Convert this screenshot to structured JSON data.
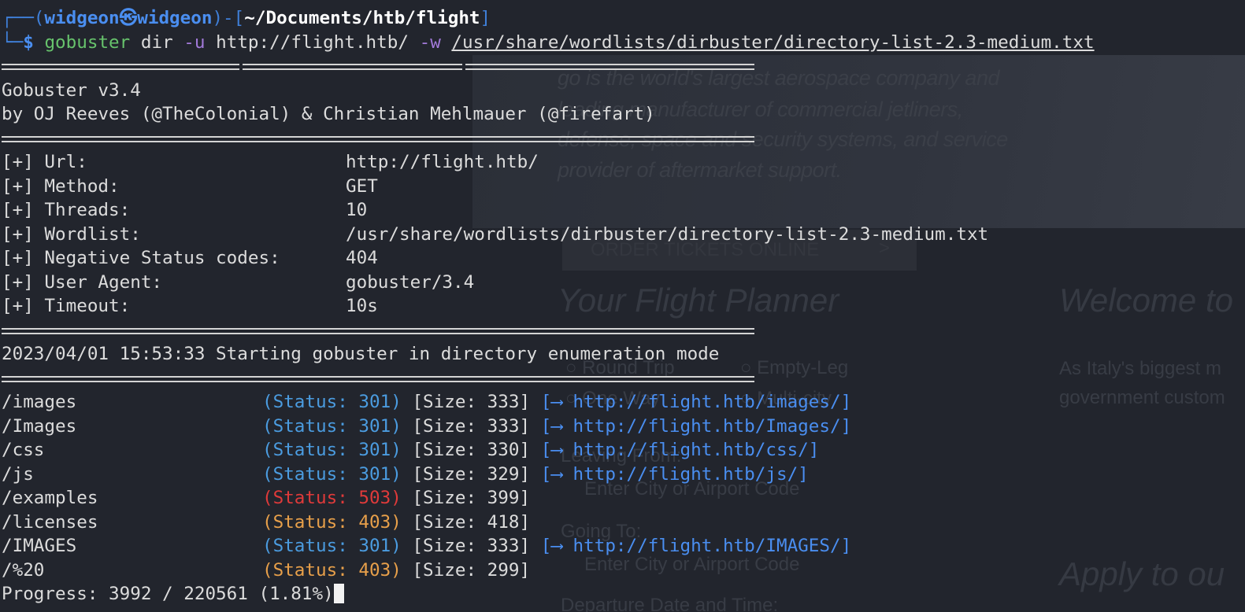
{
  "background_page": {
    "hero_lines": [
      "go is the world's largest aerospace company and",
      "leading manufacturer of commercial jetliners,",
      "defense, space and security systems, and service",
      "provider of aftermarket support."
    ],
    "order_button": "ORDER TICKETS ONLINE",
    "order_arrow": ">",
    "planner_heading": "Your Flight Planner",
    "welcome_heading": "Welcome to",
    "trip_options": [
      "Round Trip",
      "Empty-Leg",
      "One Way",
      "Multi-city"
    ],
    "intro_lines": [
      "As Italy's biggest m",
      "government custom"
    ],
    "leaving_label": "Leaving From:",
    "leaving_placeholder": "Enter City or Airport Code",
    "going_label": "Going To:",
    "going_placeholder": "Enter City or Airport Code",
    "apply_heading": "Apply to ou",
    "departure_label": "Departure Date and Time:"
  },
  "prompt": {
    "box_top": "┌──(",
    "user": "widgeon",
    "at": "㉿",
    "host": "widgeon",
    "mid": ")-[",
    "cwd": "~/Documents/htb/flight",
    "end": "]",
    "box_bottom": "└─",
    "dollar": "$"
  },
  "command": {
    "program": "gobuster",
    "sub": "dir",
    "flag_u": "-u",
    "url": "http://flight.htb/",
    "flag_w": "-w",
    "wordlist": "/usr/share/wordlists/dirbuster/directory-list-2.3-medium.txt"
  },
  "banner": {
    "version": "Gobuster v3.4",
    "authors": "by OJ Reeves (@TheColonial) & Christian Mehlmauer (@firefart)"
  },
  "config": [
    {
      "label": "[+] Url:",
      "value": "http://flight.htb/"
    },
    {
      "label": "[+] Method:",
      "value": "GET"
    },
    {
      "label": "[+] Threads:",
      "value": "10"
    },
    {
      "label": "[+] Wordlist:",
      "value": "/usr/share/wordlists/dirbuster/directory-list-2.3-medium.txt"
    },
    {
      "label": "[+] Negative Status codes:",
      "value": "404"
    },
    {
      "label": "[+] User Agent:",
      "value": "gobuster/3.4"
    },
    {
      "label": "[+] Timeout:",
      "value": "10s"
    }
  ],
  "start_message": "2023/04/01 15:53:33 Starting gobuster in directory enumeration mode",
  "results": [
    {
      "path": "/images",
      "status": "(Status: 301)",
      "size": "[Size: 333]",
      "redirect": "[⟶ http://flight.htb/images/]",
      "color": "#4b9ce0"
    },
    {
      "path": "/Images",
      "status": "(Status: 301)",
      "size": "[Size: 333]",
      "redirect": "[⟶ http://flight.htb/Images/]",
      "color": "#4b9ce0"
    },
    {
      "path": "/css",
      "status": "(Status: 301)",
      "size": "[Size: 330]",
      "redirect": "[⟶ http://flight.htb/css/]",
      "color": "#4b9ce0"
    },
    {
      "path": "/js",
      "status": "(Status: 301)",
      "size": "[Size: 329]",
      "redirect": "[⟶ http://flight.htb/js/]",
      "color": "#4b9ce0"
    },
    {
      "path": "/examples",
      "status": "(Status: 503)",
      "size": "[Size: 399]",
      "redirect": "",
      "color": "#e03a3a"
    },
    {
      "path": "/licenses",
      "status": "(Status: 403)",
      "size": "[Size: 418]",
      "redirect": "",
      "color": "#e8a04a"
    },
    {
      "path": "/IMAGES",
      "status": "(Status: 301)",
      "size": "[Size: 333]",
      "redirect": "[⟶ http://flight.htb/IMAGES/]",
      "color": "#4b9ce0"
    },
    {
      "path": "/%20",
      "status": "(Status: 403)",
      "size": "[Size: 299]",
      "redirect": "",
      "color": "#e8a04a"
    }
  ],
  "progress": "Progress: 3992 / 220561 (1.81%)",
  "colors": {
    "terminal_bg": "#22252d",
    "text": "#dcdcdc",
    "prompt_blue": "#4a8ef0",
    "command_green": "#67c36c",
    "flag_purple": "#a27ad9",
    "status_301": "#4b9ce0",
    "status_403": "#e8a04a",
    "status_503": "#e03a3a"
  }
}
